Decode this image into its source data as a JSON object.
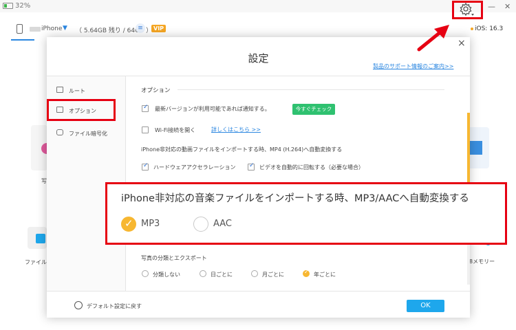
{
  "status": {
    "battery_percent": "32%",
    "battery_level": 0.32
  },
  "window_controls": {
    "minimize": "—",
    "close": "✕"
  },
  "device_bar": {
    "device_name": "iPhone",
    "storage": "（ 5.64GB 残り / 64GB ）",
    "vip_badge": "VIP",
    "ios_version": "iOS: 16.3",
    "menu_icon": "hamburger-icon",
    "gear_icon": "gear-icon"
  },
  "background": {
    "label_photo": "写",
    "label_encrypt": "ファイル暗",
    "label_memory": "8メモリー"
  },
  "dialog": {
    "title": "設定",
    "close_label": "×",
    "support_link": "製品のサポート情報のご案内>>",
    "sidebar": {
      "items": [
        {
          "label": "ルート",
          "icon": "folder-icon"
        },
        {
          "label": "オプション",
          "icon": "options-icon"
        },
        {
          "label": "ファイル暗号化",
          "icon": "lock-icon"
        }
      ]
    },
    "section_option": "オプション",
    "notify_update": {
      "label": "最新バージョンが利用可能であれば通知する。",
      "checked": true
    },
    "check_now_button": "今すぐチェック",
    "wifi_connect": {
      "label": "Wi-Fi接続を開く",
      "checked": false
    },
    "details_link": "詳しくはこちら >>",
    "video_convert_heading": "iPhone非対応の動画ファイルをインポートする時、MP4 (H.264)へ自動変換する",
    "hardware_accel": {
      "label": "ハードウェアアクセラレーション",
      "checked": true
    },
    "auto_rotate": {
      "label": "ビデオを自動的に回転する（必要な場合）",
      "checked": true
    },
    "music_convert": {
      "heading": "iPhone非対応の音楽ファイルをインポートする時、MP3/AACへ自動変換する",
      "options": [
        {
          "label": "MP3",
          "selected": true
        },
        {
          "label": "AAC",
          "selected": false
        }
      ]
    },
    "photo_export": {
      "heading": "写真の分類とエクスポート",
      "options": [
        {
          "label": "分類しない",
          "selected": false
        },
        {
          "label": "日ごとに",
          "selected": false
        },
        {
          "label": "月ごとに",
          "selected": false
        },
        {
          "label": "年ごとに",
          "selected": true
        }
      ]
    },
    "reset_label": "デフォルト設定に戻す",
    "ok_button": "OK"
  },
  "colors": {
    "highlight_red": "#e60012",
    "accent_blue": "#2a86e0",
    "ok_blue": "#1ea7ec",
    "check_green": "#2fc170",
    "radio_orange": "#f7b731"
  }
}
